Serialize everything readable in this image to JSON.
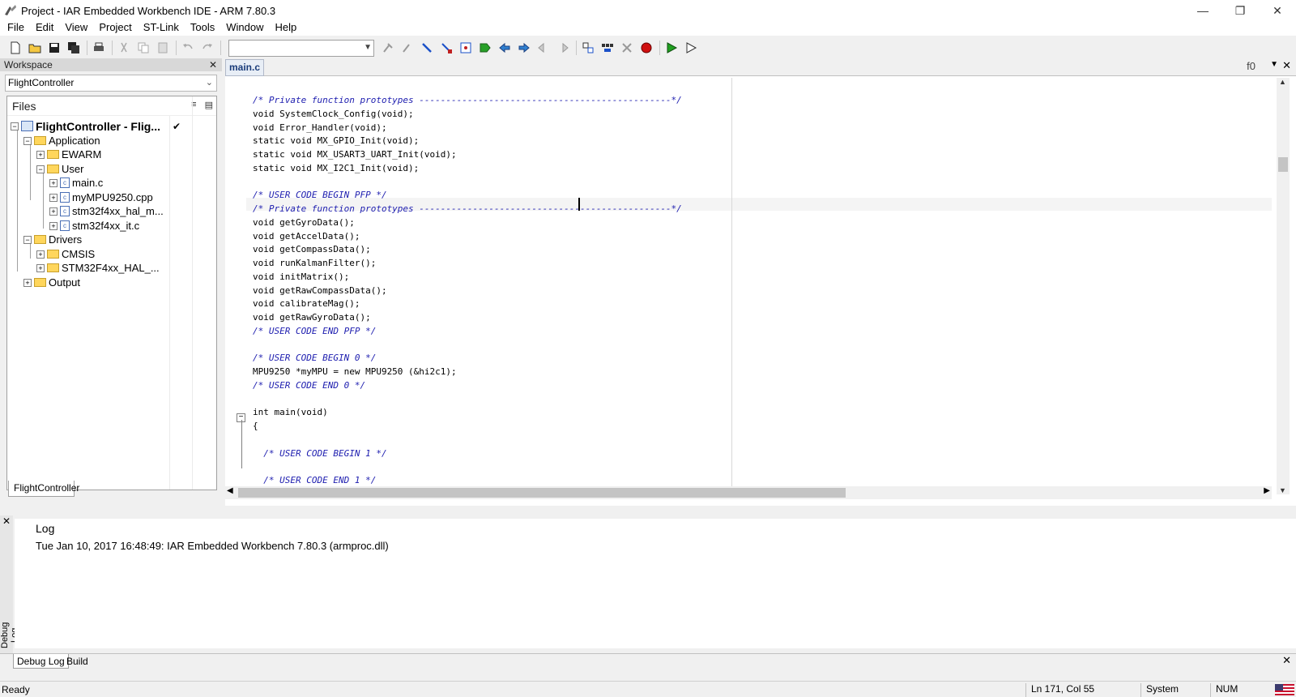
{
  "window": {
    "title": "Project - IAR Embedded Workbench IDE - ARM 7.80.3",
    "controls": {
      "minimize": "—",
      "restore": "❐",
      "close": "✕"
    }
  },
  "menu": [
    "File",
    "Edit",
    "View",
    "Project",
    "ST-Link",
    "Tools",
    "Window",
    "Help"
  ],
  "workspace": {
    "header": "Workspace",
    "selected_config": "FlightController",
    "files_label": "Files",
    "tab": "FlightController",
    "tree": [
      {
        "label": "FlightController - Flig...",
        "kind": "project",
        "level": 0,
        "checked": "✔"
      },
      {
        "label": "Application",
        "kind": "folder",
        "level": 1
      },
      {
        "label": "EWARM",
        "kind": "folder",
        "level": 2
      },
      {
        "label": "User",
        "kind": "folder",
        "level": 2
      },
      {
        "label": "main.c",
        "kind": "file",
        "level": 3
      },
      {
        "label": "myMPU9250.cpp",
        "kind": "file",
        "level": 3
      },
      {
        "label": "stm32f4xx_hal_m...",
        "kind": "file",
        "level": 3
      },
      {
        "label": "stm32f4xx_it.c",
        "kind": "file",
        "level": 3
      },
      {
        "label": "Drivers",
        "kind": "folder",
        "level": 1
      },
      {
        "label": "CMSIS",
        "kind": "folder",
        "level": 2
      },
      {
        "label": "STM32F4xx_HAL_...",
        "kind": "folder",
        "level": 2
      },
      {
        "label": "Output",
        "kind": "folder",
        "level": 1
      }
    ]
  },
  "editor": {
    "tab": "main.c",
    "function_selector": "f0",
    "lines": [
      {
        "text": "/* Private function prototypes -----------------------------------------------*/",
        "comment": true
      },
      {
        "text": "void SystemClock_Config(void);",
        "comment": false
      },
      {
        "text": "void Error_Handler(void);",
        "comment": false
      },
      {
        "text": "static void MX_GPIO_Init(void);",
        "comment": false
      },
      {
        "text": "static void MX_USART3_UART_Init(void);",
        "comment": false
      },
      {
        "text": "static void MX_I2C1_Init(void);",
        "comment": false
      },
      {
        "text": "",
        "comment": false
      },
      {
        "text": "/* USER CODE BEGIN PFP */",
        "comment": true
      },
      {
        "text": "/* Private function prototypes -----------------------------------------------*/",
        "comment": true
      },
      {
        "text": "void getGyroData();",
        "comment": false
      },
      {
        "text": "void getAccelData();",
        "comment": false
      },
      {
        "text": "void getCompassData();",
        "comment": false
      },
      {
        "text": "void runKalmanFilter();",
        "comment": false
      },
      {
        "text": "void initMatrix();",
        "comment": false
      },
      {
        "text": "void getRawCompassData();",
        "comment": false
      },
      {
        "text": "void calibrateMag();",
        "comment": false
      },
      {
        "text": "void getRawGyroData();",
        "comment": false
      },
      {
        "text": "/* USER CODE END PFP */",
        "comment": true
      },
      {
        "text": "",
        "comment": false
      },
      {
        "text": "/* USER CODE BEGIN 0 */",
        "comment": true
      },
      {
        "text": "MPU9250 *myMPU = new MPU9250 (&hi2c1);",
        "comment": false
      },
      {
        "text": "/* USER CODE END 0 */",
        "comment": true
      },
      {
        "text": "",
        "comment": false
      },
      {
        "text": "int main(void)",
        "comment": false
      },
      {
        "text": "{",
        "comment": false
      },
      {
        "text": "",
        "comment": false
      },
      {
        "text": "  /* USER CODE BEGIN 1 */",
        "comment": true
      },
      {
        "text": "",
        "comment": false
      },
      {
        "text": "  /* USER CODE END 1 */",
        "comment": true
      }
    ]
  },
  "log": {
    "side_label": "Debug Log",
    "title": "Log",
    "entries": [
      "Tue Jan 10, 2017 16:48:49: IAR Embedded Workbench 7.80.3 (armproc.dll)"
    ],
    "tabs": [
      "Debug Log",
      "Build"
    ]
  },
  "status": {
    "ready": "Ready",
    "position": "Ln 171, Col 55",
    "encoding": "System",
    "num": "NUM"
  },
  "colors": {
    "comment": "#2020b0",
    "folder": "#ffd65c",
    "accent": "#1a3c7a"
  }
}
